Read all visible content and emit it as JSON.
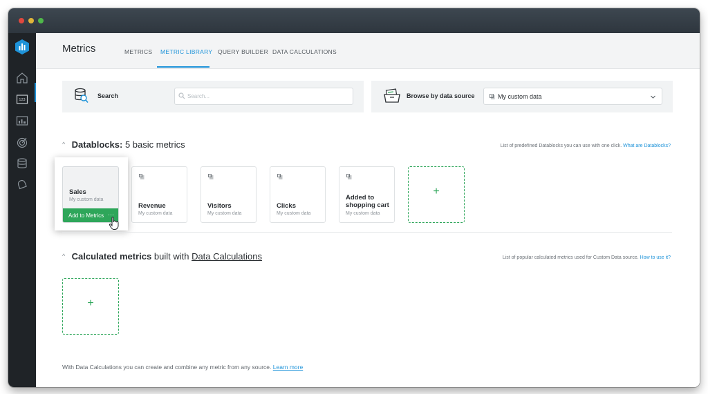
{
  "app": {
    "title": "Metrics",
    "tabs": [
      {
        "label": "METRICS",
        "active": false
      },
      {
        "label": "METRIC LIBRARY",
        "active": true
      },
      {
        "label": "QUERY BUILDER",
        "active": false
      },
      {
        "label": "DATA CALCULATIONS",
        "active": false
      }
    ]
  },
  "sidebar": {
    "items": [
      "home-icon",
      "number-tile-icon",
      "dashboard-icon",
      "goal-icon",
      "database-icon",
      "bell-icon"
    ],
    "active_item": "number-tile-icon"
  },
  "search": {
    "label": "Search",
    "placeholder": "Search..."
  },
  "browse": {
    "label": "Browse by data source",
    "selected": "My custom data"
  },
  "datablocks": {
    "heading_bold": "Datablocks:",
    "heading_rest": "5 basic metrics",
    "note": "List of predefined Datablocks you can use with one click.",
    "note_link": "What are Datablocks?",
    "cards": [
      {
        "title": "Sales",
        "subtitle": "My custom data",
        "action": "Add to Metrics",
        "more": "···"
      },
      {
        "title": "Revenue",
        "subtitle": "My custom data"
      },
      {
        "title": "Visitors",
        "subtitle": "My custom data"
      },
      {
        "title": "Clicks",
        "subtitle": "My custom data"
      },
      {
        "title": "Added to shopping cart",
        "subtitle": "My custom data"
      }
    ],
    "add_symbol": "+"
  },
  "calculated": {
    "heading_bold": "Calculated metrics",
    "heading_mid": "built with",
    "heading_link": "Data Calculations",
    "note": "List of popular calculated metrics used for Custom Data source.",
    "note_link": "How to use it?",
    "add_symbol": "+"
  },
  "footer": {
    "text": "With Data Calculations you can create and combine any metric from any source.",
    "link": "Learn more"
  },
  "colors": {
    "accent": "#1e93d9",
    "green": "#2ea65a",
    "sidebar": "#1f2327"
  }
}
